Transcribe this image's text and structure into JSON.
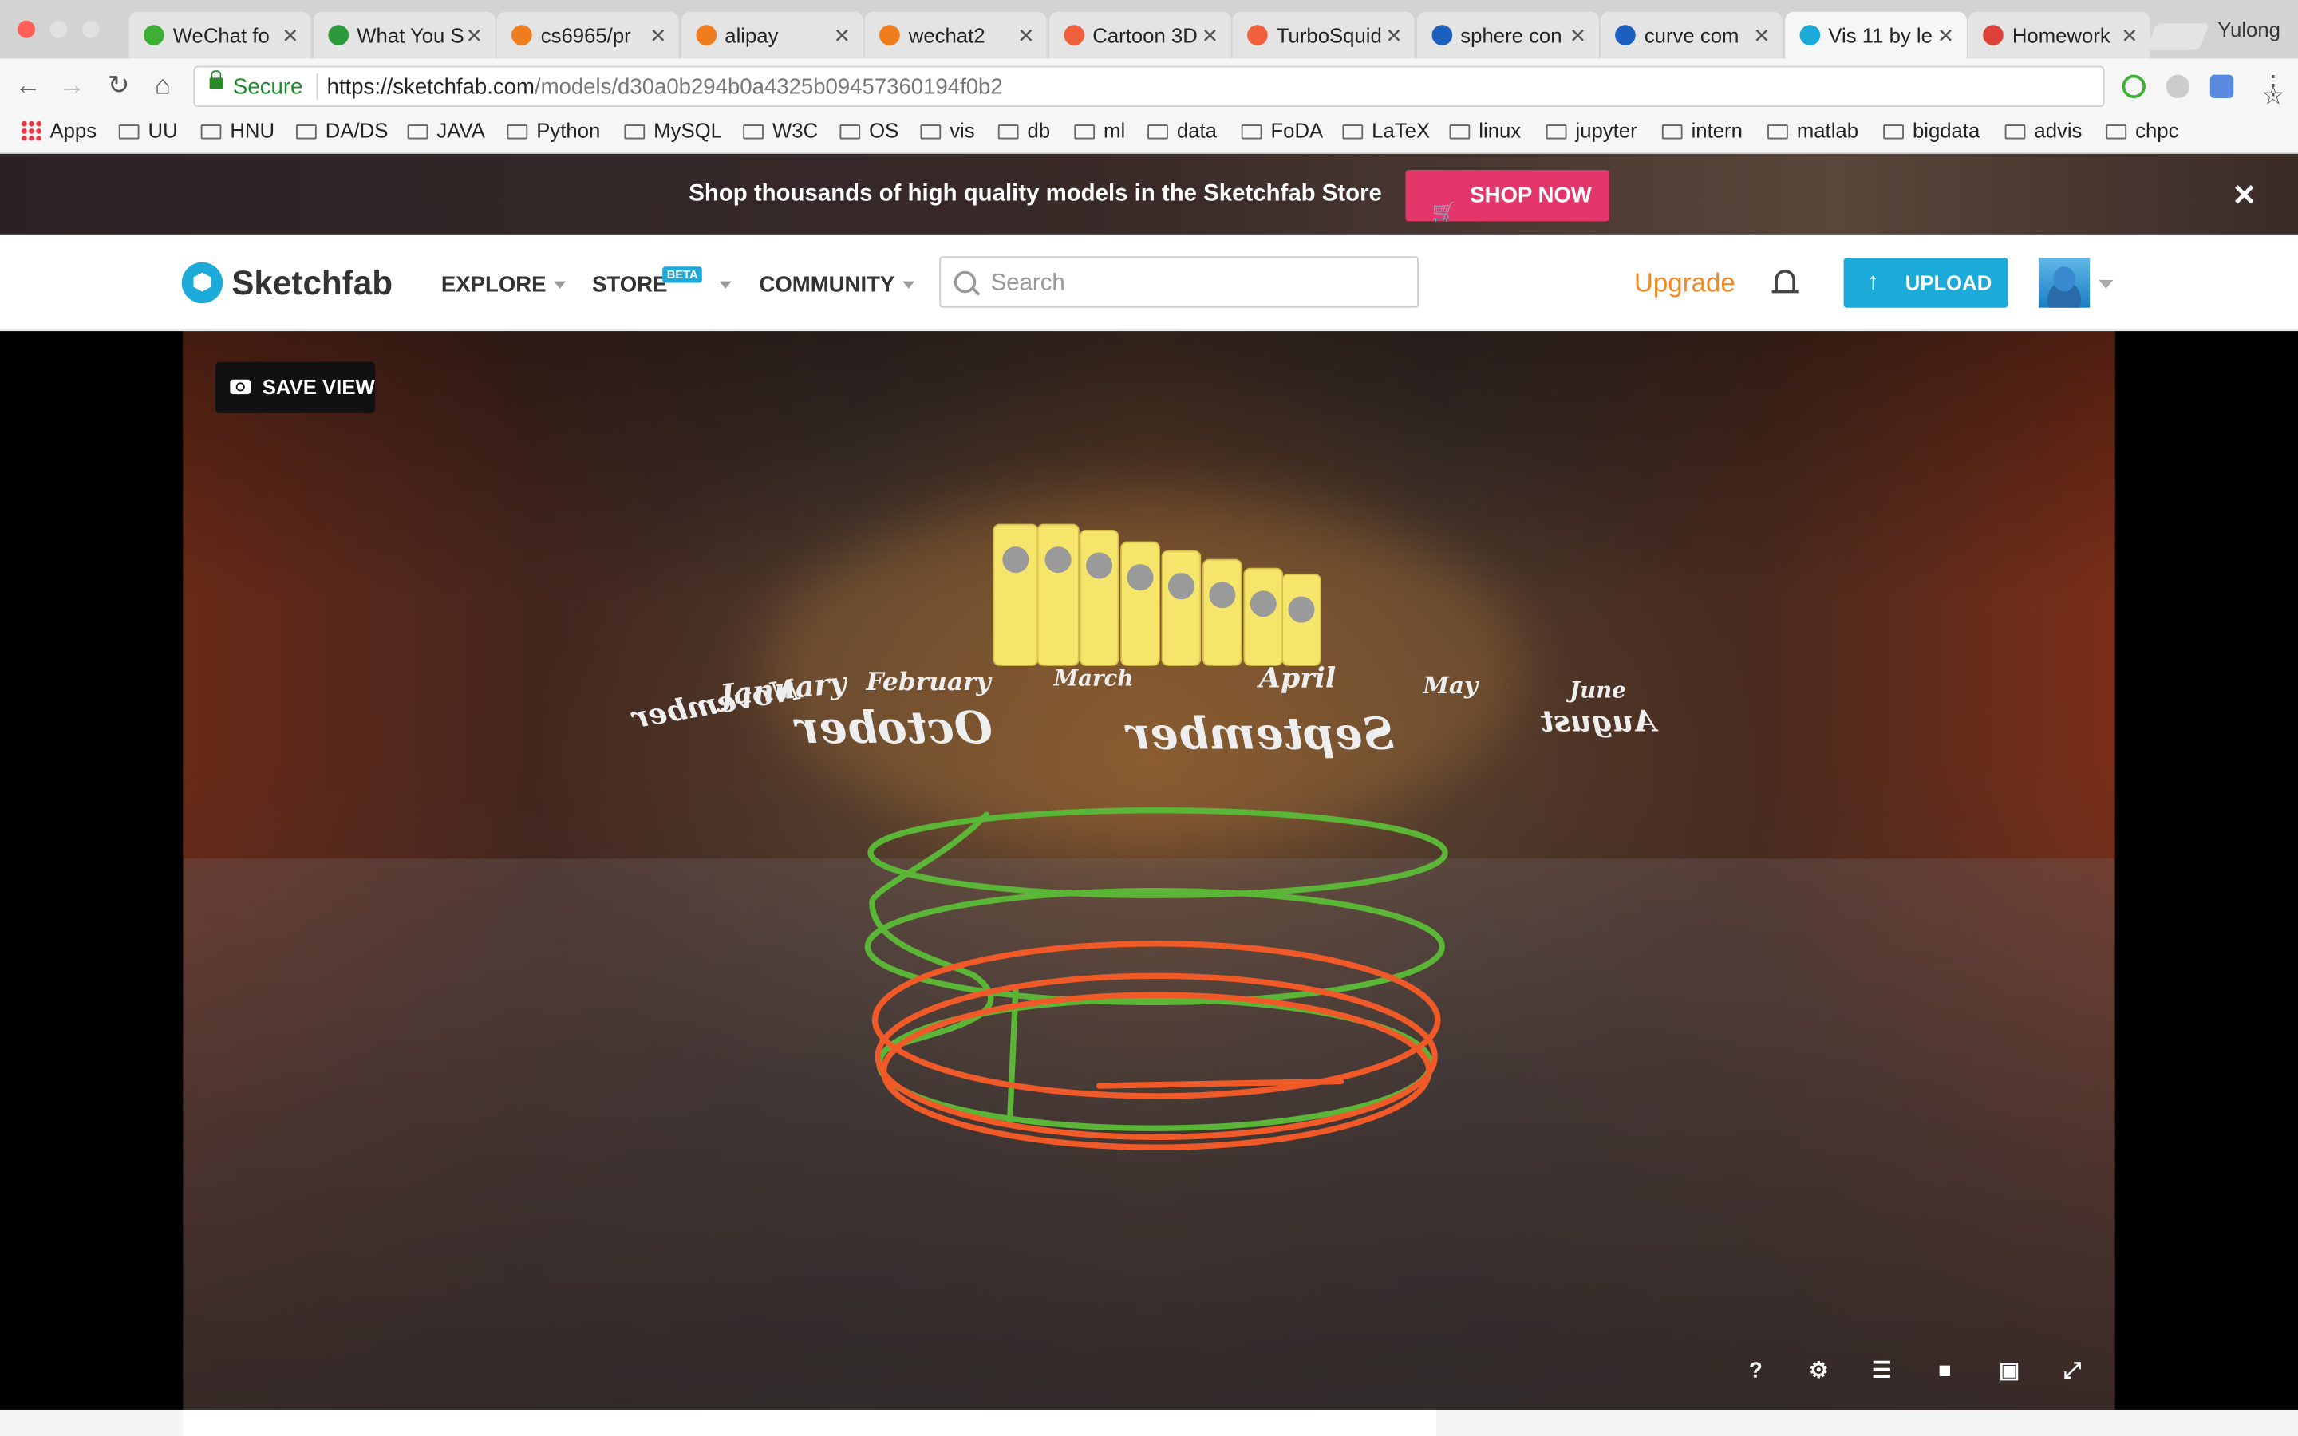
{
  "browser": {
    "tabs": [
      {
        "title": "WeChat fo",
        "favicon_color": "#3cb034"
      },
      {
        "title": "What You S",
        "favicon_color": "#2a9a3a"
      },
      {
        "title": "cs6965/pr",
        "favicon_color": "#f07c1e"
      },
      {
        "title": "alipay",
        "favicon_color": "#f07c1e"
      },
      {
        "title": "wechat2",
        "favicon_color": "#f07c1e"
      },
      {
        "title": "Cartoon 3D",
        "favicon_color": "#f0603a"
      },
      {
        "title": "TurboSquid",
        "favicon_color": "#f0603a"
      },
      {
        "title": "sphere con",
        "favicon_color": "#1b5fbf"
      },
      {
        "title": "curve com",
        "favicon_color": "#1b5fbf"
      },
      {
        "title": "Vis 11 by le",
        "favicon_color": "#1caad9",
        "active": true
      },
      {
        "title": "Homework",
        "favicon_color": "#e0403a"
      }
    ],
    "profile_name": "Yulong",
    "secure_label": "Secure",
    "url_host": "https://sketchfab.com",
    "url_path": "/models/d30a0b294b0a4325b09457360194f0b2",
    "bookmarks": [
      "Apps",
      "UU",
      "HNU",
      "DA/DS",
      "JAVA",
      "Python",
      "MySQL",
      "W3C",
      "OS",
      "vis",
      "db",
      "ml",
      "data",
      "FoDA",
      "LaTeX",
      "linux",
      "jupyter",
      "intern",
      "matlab",
      "bigdata",
      "advis",
      "chpc"
    ]
  },
  "promo": {
    "text": "Shop thousands of high quality models in the Sketchfab Store",
    "button": "SHOP NOW"
  },
  "header": {
    "logo": "Sketchfab",
    "nav": [
      "EXPLORE",
      "STORE",
      "COMMUNITY"
    ],
    "beta_badge": "BETA",
    "search_placeholder": "Search",
    "upgrade": "Upgrade",
    "upload": "UPLOAD"
  },
  "viewer": {
    "save_view": "SAVE VIEW",
    "month_labels": [
      "January",
      "February",
      "March",
      "April",
      "May",
      "June",
      "August",
      "October",
      "September",
      "November"
    ],
    "controls": [
      "help",
      "settings",
      "layers",
      "vr",
      "embed",
      "fullscreen"
    ],
    "colors": {
      "bars": "#f5e56b",
      "ring_green": "#5bb537",
      "ring_red": "#f05a28"
    }
  },
  "colors": {
    "accent": "#1caad9",
    "shop": "#e3366b",
    "upgrade": "#f08a24"
  }
}
